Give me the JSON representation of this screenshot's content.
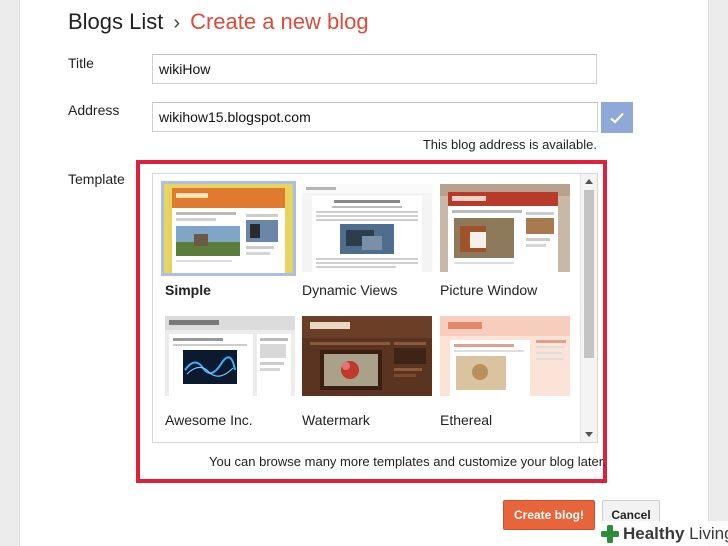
{
  "breadcrumb": {
    "root": "Blogs List",
    "separator": "›",
    "current": "Create a new blog"
  },
  "form": {
    "title_label": "Title",
    "title_value": "wikiHow",
    "address_label": "Address",
    "address_value": "wikihow15.blogspot.com",
    "availability_text": "This blog address is available.",
    "template_label": "Template"
  },
  "templates": [
    {
      "name": "Simple",
      "selected": true
    },
    {
      "name": "Dynamic Views",
      "selected": false
    },
    {
      "name": "Picture Window",
      "selected": false
    },
    {
      "name": "Awesome Inc.",
      "selected": false
    },
    {
      "name": "Watermark",
      "selected": false
    },
    {
      "name": "Ethereal",
      "selected": false
    }
  ],
  "browse_note": "You can browse many more templates and customize your blog later.",
  "buttons": {
    "create": "Create blog!",
    "cancel": "Cancel"
  },
  "watermark": {
    "bold": "Healthy",
    "rest": " Living"
  },
  "colors": {
    "accent": "#dd4b39",
    "create_button": "#e8643a",
    "highlight_frame": "#e0203a",
    "check_button": "#8ea9d8",
    "selected_border": "#a9bfe6"
  }
}
